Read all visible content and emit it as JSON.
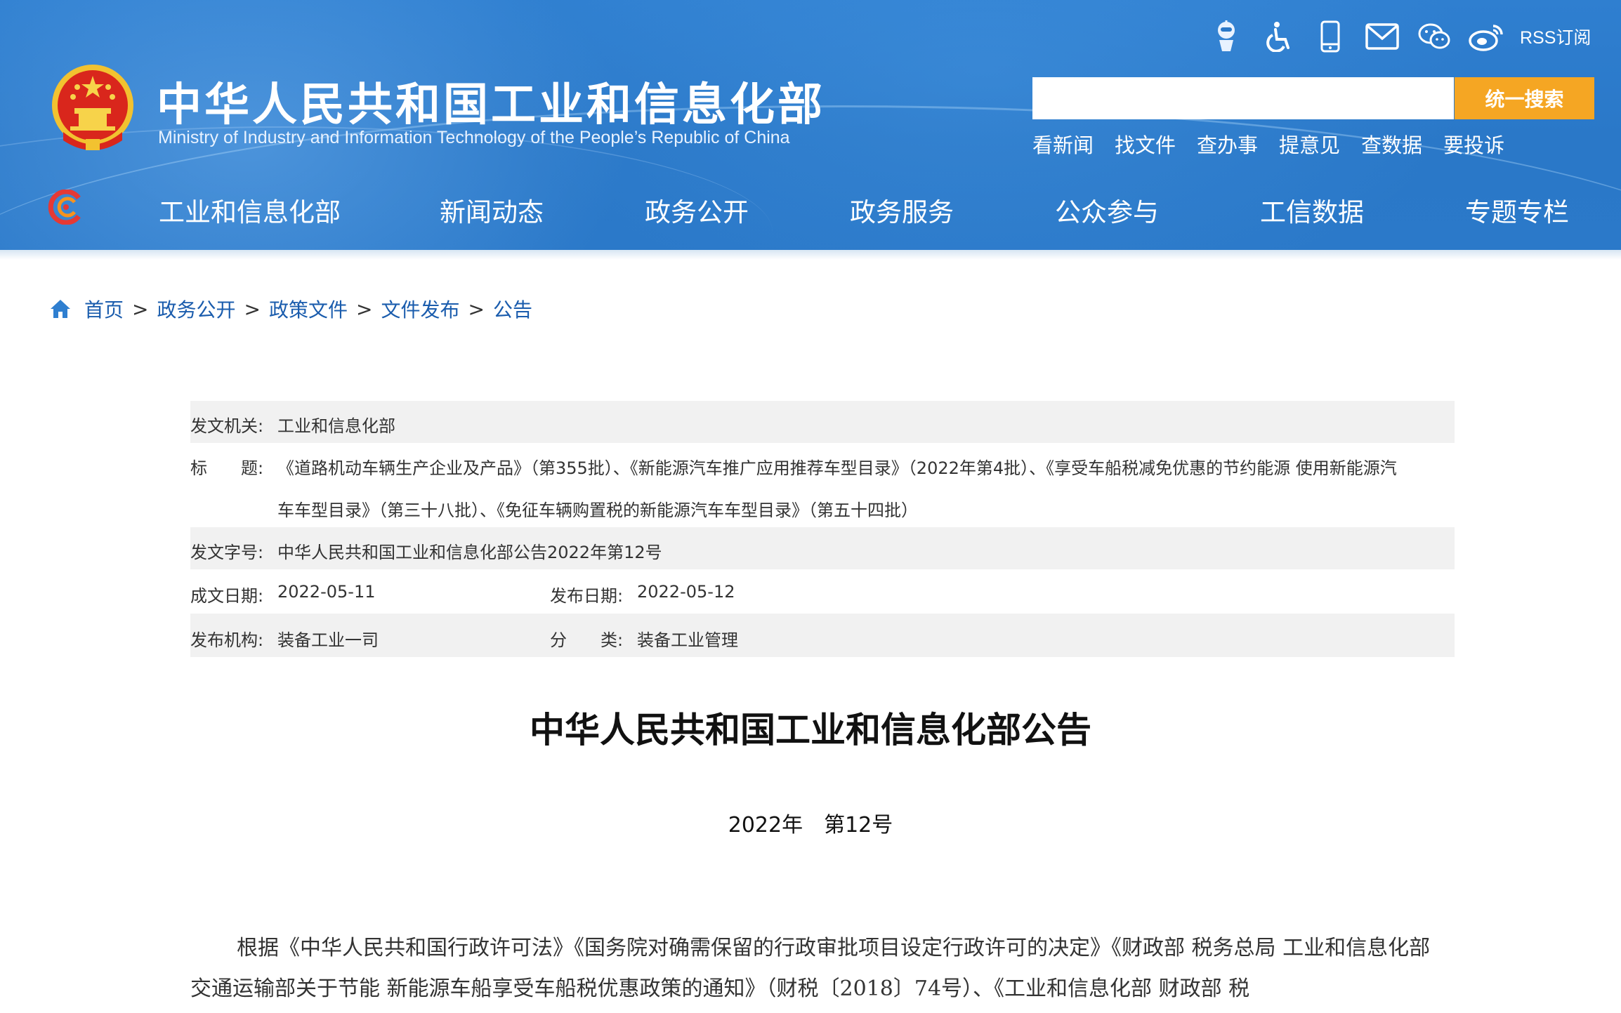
{
  "header": {
    "title": "中华人民共和国工业和信息化部",
    "subtitle": "Ministry of Industry and Information Technology of the People’s Republic of China",
    "icons": [
      "robot-assistant-icon",
      "accessibility-icon",
      "mobile-icon",
      "mail-icon",
      "wechat-icon",
      "weibo-icon"
    ],
    "rss_label": "RSS订阅",
    "search_placeholder": "",
    "search_button": "统一搜索",
    "quick_links": [
      "看新闻",
      "找文件",
      "查办事",
      "提意见",
      "查数据",
      "要投诉"
    ],
    "nav": [
      "工业和信息化部",
      "新闻动态",
      "政务公开",
      "政务服务",
      "公众参与",
      "工信数据",
      "专题专栏"
    ]
  },
  "breadcrumb": {
    "items": [
      "首页",
      "政务公开",
      "政策文件",
      "文件发布",
      "公告"
    ],
    "separator": ">"
  },
  "meta": {
    "issuer_label": "发文机关:",
    "issuer": "工业和信息化部",
    "title_label": "标　　题:",
    "title_line1": "《道路机动车辆生产企业及产品》（第355批）、《新能源汽车推广应用推荐车型目录》（2022年第4批）、《享受车船税减免优惠的节约能源 使用新能源汽",
    "title_line2": "车车型目录》（第三十八批）、《免征车辆购置税的新能源汽车车型目录》（第五十四批）",
    "docno_label": "发文字号:",
    "docno": "中华人民共和国工业和信息化部公告2022年第12号",
    "created_label": "成文日期:",
    "created": "2022-05-11",
    "published_label": "发布日期:",
    "published": "2022-05-12",
    "org_label": "发布机构:",
    "org": "装备工业一司",
    "category_label": "分　　类:",
    "category": "装备工业管理"
  },
  "document": {
    "title": "中华人民共和国工业和信息化部公告",
    "number": "2022年　第12号",
    "paragraph": "根据《中华人民共和国行政许可法》《国务院对确需保留的行政审批项目设定行政许可的决定》《财政部 税务总局 工业和信息化部 交通运输部关于节能 新能源车船享受车船税优惠政策的通知》（财税〔2018〕74号）、《工业和信息化部 财政部 税"
  },
  "colors": {
    "header_blue": "#2a78c8",
    "search_button": "#f5a623",
    "link_blue": "#1a5cad",
    "row_gray": "#f1f1f1"
  }
}
